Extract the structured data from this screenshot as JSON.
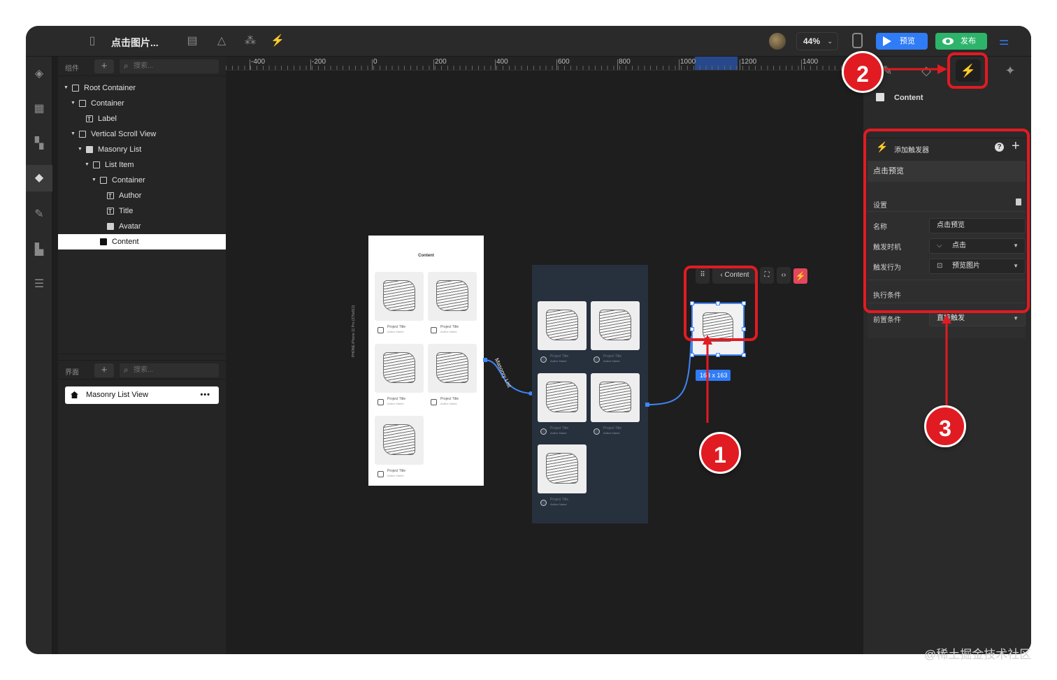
{
  "topbar": {
    "title": "点击图片...",
    "zoom": "44%",
    "preview_label": "预览",
    "publish_label": "发布"
  },
  "layers": {
    "components_label": "组件",
    "search_placeholder": "搜索...",
    "tree": [
      {
        "label": "Root Container",
        "depth": 0,
        "icon": "container"
      },
      {
        "label": "Container",
        "depth": 1,
        "icon": "container"
      },
      {
        "label": "Label",
        "depth": 2,
        "icon": "text"
      },
      {
        "label": "Vertical Scroll View",
        "depth": 1,
        "icon": "scroll"
      },
      {
        "label": "Masonry List",
        "depth": 2,
        "icon": "masonry"
      },
      {
        "label": "List Item",
        "depth": 3,
        "icon": "list-item"
      },
      {
        "label": "Container",
        "depth": 4,
        "icon": "container"
      },
      {
        "label": "Author",
        "depth": 5,
        "icon": "text"
      },
      {
        "label": "Title",
        "depth": 5,
        "icon": "text"
      },
      {
        "label": "Avatar",
        "depth": 5,
        "icon": "image"
      },
      {
        "label": "Content",
        "depth": 4,
        "icon": "image",
        "selected": true
      }
    ],
    "pages_label": "界面",
    "pages_search_placeholder": "搜索...",
    "page_item": "Masonry List View",
    "page_item_more": "•••"
  },
  "ruler": {
    "labels": [
      "-400",
      "-200",
      "0",
      "200",
      "400",
      "600",
      "800",
      "1000",
      "1200",
      "1400"
    ]
  },
  "canvas": {
    "frame_title": "Content",
    "side_label": "iPhone 11 Pro (375x812)",
    "side_tag": "PHONE",
    "card_title": "Project Title",
    "card_author": "Author Name",
    "connector_label": "Masonry List",
    "floating_bar_label": "Content",
    "size_tag": "163 x 163"
  },
  "inspector": {
    "selected_name": "Content",
    "add_trigger_label": "添加触发器",
    "trigger_name_header": "点击预览",
    "settings_label": "设置",
    "fields": {
      "name_label": "名称",
      "name_value": "点击预览",
      "when_label": "触发时机",
      "when_value": "点击",
      "action_label": "触发行为",
      "action_value": "预览图片",
      "conditions_label": "执行条件",
      "precondition_label": "前置条件",
      "precondition_value": "直接触发"
    }
  },
  "annotations": {
    "badge1": "1",
    "badge2": "2",
    "badge3": "3",
    "highlight_color": "#e11b22"
  },
  "watermark": "@稀土掘金技术社区"
}
